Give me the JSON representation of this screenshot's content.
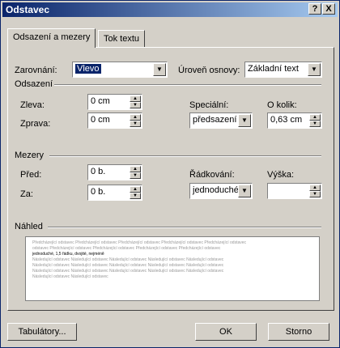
{
  "window": {
    "title": "Odstavec",
    "help_label": "?",
    "close_label": "X"
  },
  "tabs": [
    {
      "label": "Odsazení a mezery",
      "active": true
    },
    {
      "label": "Tok textu",
      "active": false
    }
  ],
  "general": {
    "alignment_label": "Zarovnání:",
    "alignment_value": "Vlevo",
    "outline_label": "Úroveň osnovy:",
    "outline_value": "Základní text"
  },
  "indent": {
    "title": "Odsazení",
    "left_label": "Zleva:",
    "left_value": "0 cm",
    "right_label": "Zprava:",
    "right_value": "0 cm",
    "special_label": "Speciální:",
    "special_value": "předsazení",
    "by_label": "O kolik:",
    "by_value": "0,63 cm"
  },
  "spacing": {
    "title": "Mezery",
    "before_label": "Před:",
    "before_value": "0 b.",
    "after_label": "Za:",
    "after_value": "0 b.",
    "line_label": "Řádkování:",
    "line_value": "jednoduché",
    "at_label": "Výška:",
    "at_value": ""
  },
  "preview": {
    "title": "Náhled",
    "lines": [
      "Předcházející odstavec Předcházející odstavec Předcházející odstavec Předcházející odstavec Předcházející odstavec",
      "odstavec Předcházející odstavec Předcházející odstavec Předcházející odstavec Předcházející odstavec",
      "jednoduché, 1,5 řádku, dvojité, nejméně",
      "Následující odstavec Následující odstavec Následující odstavec Následující odstavec Následující odstavec",
      "Následující odstavec Následující odstavec Následující odstavec Následující odstavec Následující odstavec",
      "Následující odstavec Následující odstavec Následující odstavec Následující odstavec Následující odstavec",
      "Následující odstavec Následující odstavec"
    ]
  },
  "buttons": {
    "tabs_label": "Tabulátory...",
    "ok_label": "OK",
    "cancel_label": "Storno"
  }
}
